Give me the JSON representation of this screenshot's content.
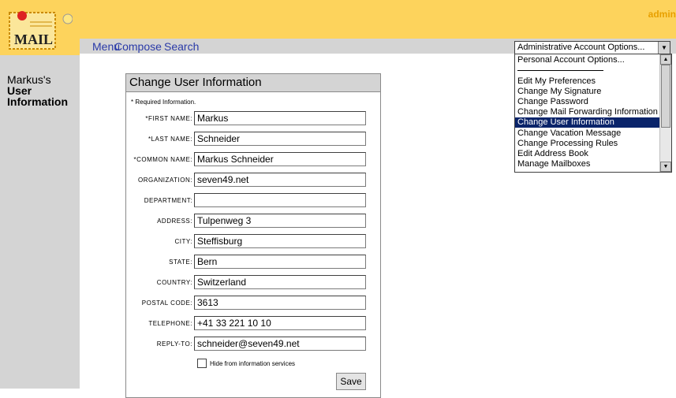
{
  "header": {
    "admin_label": "admin",
    "logo_text": "MAIL"
  },
  "nav": {
    "menu": "Menu",
    "compose": "Compose",
    "search": "Search"
  },
  "sidebar": {
    "owner": "Markus's",
    "title_line1": "User",
    "title_line2": "Information"
  },
  "form": {
    "title": "Change User Information",
    "required_note": "* Required Information.",
    "fields": [
      {
        "label": "*FIRST NAME:",
        "value": "Markus"
      },
      {
        "label": "*LAST NAME:",
        "value": "Schneider"
      },
      {
        "label": "*COMMON NAME:",
        "value": "Markus Schneider"
      },
      {
        "label": "ORGANIZATION:",
        "value": "seven49.net"
      },
      {
        "label": "DEPARTMENT:",
        "value": ""
      },
      {
        "label": "ADDRESS:",
        "value": "Tulpenweg 3"
      },
      {
        "label": "CITY:",
        "value": "Steffisburg"
      },
      {
        "label": "STATE:",
        "value": "Bern"
      },
      {
        "label": "COUNTRY:",
        "value": "Switzerland"
      },
      {
        "label": "POSTAL CODE:",
        "value": "3613"
      },
      {
        "label": "TELEPHONE:",
        "value": "+41 33 221 10 10"
      },
      {
        "label": "REPLY-TO:",
        "value": "schneider@seven49.net"
      }
    ],
    "hide_label": "Hide from information services",
    "save_label": "Save"
  },
  "dropdown": {
    "selected": "Administrative Account Options...",
    "items": [
      "Personal Account Options...",
      "Edit My Preferences",
      "Change My Signature",
      "Change Password",
      "Change Mail Forwarding Information",
      "Change User Information",
      "Change Vacation Message",
      "Change Processing Rules",
      "Edit Address Book",
      "Manage Mailboxes"
    ],
    "highlighted_index": 5
  }
}
